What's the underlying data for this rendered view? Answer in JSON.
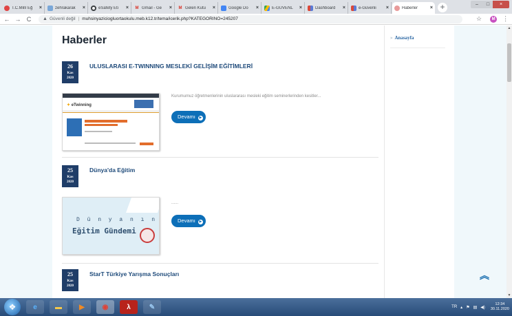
{
  "browser": {
    "tabs": [
      {
        "label": "T.C.Millî Eğ",
        "icon": "meb-icon",
        "color": "#e04444"
      },
      {
        "label": "zehrakarak",
        "icon": "account-icon",
        "color": "#7aa7d8"
      },
      {
        "label": "eSafety Eti",
        "icon": "chrome-icon",
        "color": "#3c4043"
      },
      {
        "label": "Gmail - Ge",
        "icon": "gmail-icon",
        "color": "#d93025"
      },
      {
        "label": "Gelen Kutu",
        "icon": "gmail-icon",
        "color": "#d93025"
      },
      {
        "label": "Google Do",
        "icon": "docs-icon",
        "color": "#4285f4"
      },
      {
        "label": "E-GUVENL",
        "icon": "drive-icon",
        "color": "#34a853"
      },
      {
        "label": "Dashboard",
        "icon": "dashboard-icon",
        "color": "#5b7bd5"
      },
      {
        "label": "e-Güvenli",
        "icon": "dashboard-icon",
        "color": "#5b7bd5"
      },
      {
        "label": "Haberler",
        "icon": "site-icon",
        "color": "#e89a9a",
        "active": true
      }
    ],
    "address": {
      "security": "Güvenli değil",
      "url": "muhsinyazicioglu­ortaokulu.meb.k12.tr/tema/icerik.php?KATEGORINO=245207"
    },
    "profile_initial": "M"
  },
  "page": {
    "title": "Haberler",
    "news": [
      {
        "day": "26",
        "month": "Kas",
        "year": "2020",
        "title": "ULUSLARASI E-TWINNING MESLEKİ GELİŞİM EĞİTİMLERİ",
        "excerpt": "Kurumumuz öğretmenlerinin uluslararası mesleki eğitim seminerlerinden kesitler...",
        "button": "Devamı",
        "thumb_logo": "eTwinning"
      },
      {
        "day": "25",
        "month": "Kas",
        "year": "2020",
        "title": "Dünya'da Eğitim",
        "excerpt": "......",
        "button": "Devamı",
        "thumb_line1": "D ü n y a n ı n",
        "thumb_line2": "Eğitim Gündemi"
      },
      {
        "day": "25",
        "month": "Kas",
        "year": "2020",
        "title": "StarT Türkiye Yarışma Sonuçları"
      }
    ]
  },
  "sidebar": {
    "link": "Anasayfa"
  },
  "taskbar": {
    "lang": "TR",
    "time": "12:34",
    "date": "30.11.2020"
  },
  "colors": {
    "accent": "#0d6fb8",
    "date_box": "#1f3d68",
    "news_title": "#1e4a7a"
  }
}
